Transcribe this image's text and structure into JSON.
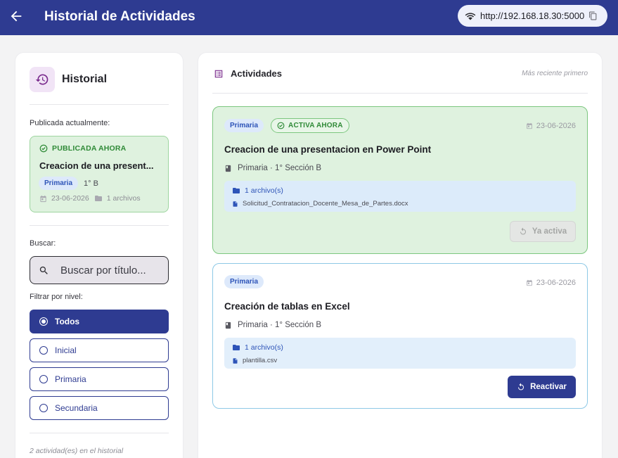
{
  "header": {
    "title": "Historial de Actividades",
    "url": "http://192.168.18.30:5000"
  },
  "sidebar": {
    "title": "Historial",
    "published_label": "Publicada actualmente:",
    "published": {
      "badge": "PUBLICADA AHORA",
      "title": "Creacion de una present...",
      "level": "Primaria",
      "grade": "1° B",
      "date": "23-06-2026",
      "files": "1 archivos"
    },
    "search_label": "Buscar:",
    "search_placeholder": "Buscar por título...",
    "filter_label": "Filtrar por nivel:",
    "filters": [
      {
        "label": "Todos",
        "selected": true
      },
      {
        "label": "Inicial",
        "selected": false
      },
      {
        "label": "Primaria",
        "selected": false
      },
      {
        "label": "Secundaria",
        "selected": false
      }
    ],
    "footer": "2 actividad(es) en el historial"
  },
  "main": {
    "title": "Actividades",
    "sort_note": "Más reciente primero",
    "activities": [
      {
        "level": "Primaria",
        "status_badge": "ACTIVA AHORA",
        "date": "23-06-2026",
        "title": "Creacion de una presentacion en Power Point",
        "subtitle": "Primaria · 1° Sección B",
        "files_count": "1 archivo(s)",
        "file_name": "Solicitud_Contratacion_Docente_Mesa_de_Partes.docx",
        "action": "Ya activa"
      },
      {
        "level": "Primaria",
        "date": "23-06-2026",
        "title": "Creación de tablas en Excel",
        "subtitle": "Primaria · 1° Sección B",
        "files_count": "1 archivo(s)",
        "file_name": "plantilla.csv",
        "action": "Reactivar"
      }
    ]
  },
  "colors": {
    "primary": "#2e3b91",
    "active_green": "#2f8a37",
    "active_bg": "#dff2df",
    "level_chip": "#2e54b8"
  }
}
